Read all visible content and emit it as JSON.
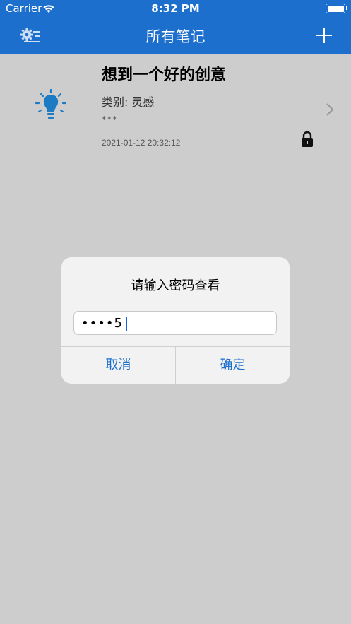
{
  "status_bar": {
    "carrier": "Carrier",
    "time": "8:32 PM"
  },
  "nav": {
    "title": "所有笔记",
    "left_icon": "settings-list-icon",
    "right_icon": "plus-icon"
  },
  "note": {
    "title": "想到一个好的创意",
    "category": "类别: 灵感",
    "preview": "***",
    "date": "2021-01-12 20:32:12",
    "icon": "lightbulb-icon",
    "locked": true
  },
  "alert": {
    "title": "请输入密码查看",
    "password_value": "••••5",
    "cancel_label": "取消",
    "confirm_label": "确定"
  },
  "colors": {
    "accent": "#1d6fce",
    "bulb": "#1d7bc4",
    "overlay_bg": "#cdcdcd"
  }
}
